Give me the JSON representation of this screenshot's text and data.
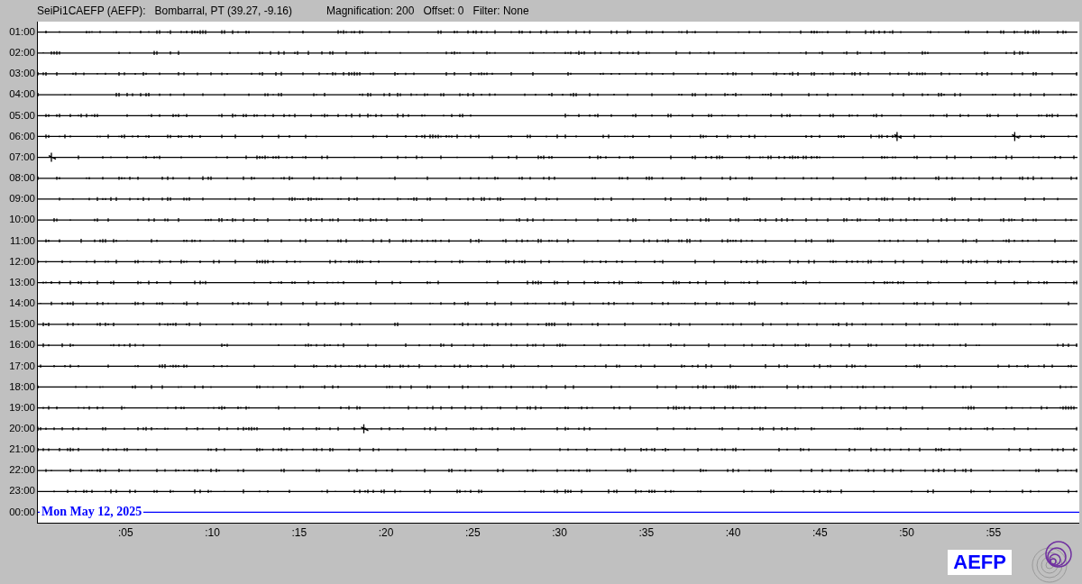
{
  "header": {
    "station": "SeiPi1CAEFP (AEFP):",
    "location": "Bombarral, PT (39.27, -9.16)",
    "magnification": "Magnification: 200",
    "offset": "Offset: 0",
    "filter": "Filter: None"
  },
  "rows": [
    {
      "label": "01:00",
      "kind": "trace"
    },
    {
      "label": "02:00",
      "kind": "trace"
    },
    {
      "label": "03:00",
      "kind": "trace"
    },
    {
      "label": "04:00",
      "kind": "trace"
    },
    {
      "label": "05:00",
      "kind": "trace"
    },
    {
      "label": "06:00",
      "kind": "trace"
    },
    {
      "label": "07:00",
      "kind": "trace"
    },
    {
      "label": "08:00",
      "kind": "trace"
    },
    {
      "label": "09:00",
      "kind": "trace"
    },
    {
      "label": "10:00",
      "kind": "trace"
    },
    {
      "label": "11:00",
      "kind": "trace"
    },
    {
      "label": "12:00",
      "kind": "trace"
    },
    {
      "label": "13:00",
      "kind": "trace"
    },
    {
      "label": "14:00",
      "kind": "trace"
    },
    {
      "label": "15:00",
      "kind": "trace"
    },
    {
      "label": "16:00",
      "kind": "trace"
    },
    {
      "label": "17:00",
      "kind": "trace"
    },
    {
      "label": "18:00",
      "kind": "trace"
    },
    {
      "label": "19:00",
      "kind": "trace"
    },
    {
      "label": "20:00",
      "kind": "trace"
    },
    {
      "label": "21:00",
      "kind": "trace"
    },
    {
      "label": "22:00",
      "kind": "trace"
    },
    {
      "label": "23:00",
      "kind": "trace"
    },
    {
      "label": "00:00",
      "kind": "current"
    }
  ],
  "date_label": "Mon May 12, 2025",
  "minute_labels": [
    ":05",
    ":10",
    ":15",
    ":20",
    ":25",
    ":30",
    ":35",
    ":40",
    ":45",
    ":50",
    ":55"
  ],
  "logo_text": "AEFP"
}
